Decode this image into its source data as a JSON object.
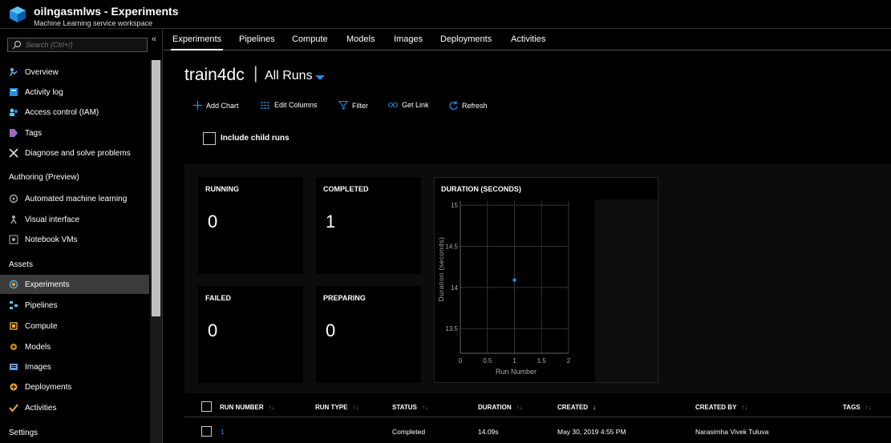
{
  "app": {
    "title": "oilngasmlws - Experiments",
    "subtitle": "Machine Learning service workspace",
    "brand_color": "#1f8fe5"
  },
  "search": {
    "placeholder": "Search (Ctrl+/)"
  },
  "sidebar": {
    "items_top": [
      {
        "label": "Overview",
        "icon": "overview-icon"
      },
      {
        "label": "Activity log",
        "icon": "activity-log-icon"
      },
      {
        "label": "Access control (IAM)",
        "icon": "access-control-icon"
      },
      {
        "label": "Tags",
        "icon": "tag-icon"
      },
      {
        "label": "Diagnose and solve problems",
        "icon": "wrench-icon"
      }
    ],
    "section_authoring": "Authoring (Preview)",
    "items_authoring": [
      {
        "label": "Automated machine learning",
        "icon": "automl-icon"
      },
      {
        "label": "Visual interface",
        "icon": "visual-interface-icon"
      },
      {
        "label": "Notebook VMs",
        "icon": "notebook-icon"
      }
    ],
    "section_assets": "Assets",
    "items_assets": [
      {
        "label": "Experiments",
        "icon": "experiments-icon",
        "selected": true
      },
      {
        "label": "Pipelines",
        "icon": "pipelines-icon"
      },
      {
        "label": "Compute",
        "icon": "compute-icon"
      },
      {
        "label": "Models",
        "icon": "models-icon"
      },
      {
        "label": "Images",
        "icon": "images-icon"
      },
      {
        "label": "Deployments",
        "icon": "deployments-icon"
      },
      {
        "label": "Activities",
        "icon": "activities-icon"
      }
    ],
    "section_settings": "Settings"
  },
  "tabs": [
    "Experiments",
    "Pipelines",
    "Compute",
    "Models",
    "Images",
    "Deployments",
    "Activities"
  ],
  "experiment": {
    "name": "train4dc",
    "separator": "|",
    "run_filter": "All Runs"
  },
  "toolbar": {
    "add_chart": "Add Chart",
    "edit_columns": "Edit Columns",
    "filter": "Filter",
    "get_link": "Get Link",
    "refresh": "Refresh"
  },
  "include_child_runs": "Include child runs",
  "cards": {
    "running": {
      "label": "RUNNING",
      "value": "0"
    },
    "completed": {
      "label": "COMPLETED",
      "value": "1"
    },
    "failed": {
      "label": "FAILED",
      "value": "0"
    },
    "preparing": {
      "label": "PREPARING",
      "value": "0"
    }
  },
  "chart_data": {
    "type": "scatter",
    "title": "DURATION (SECONDS)",
    "xlabel": "Run Number",
    "ylabel": "Duration (seconds)",
    "x_ticks": [
      "0",
      "0.5",
      "1",
      "1.5",
      "2"
    ],
    "y_ticks": [
      "15",
      "14.5",
      "14",
      "13.5"
    ],
    "xlim": [
      0,
      2
    ],
    "ylim": [
      13.2,
      15.05
    ],
    "grid": true,
    "points": [
      {
        "x": 1,
        "y": 14.09
      }
    ],
    "color": "#1f8fe5"
  },
  "table": {
    "columns": [
      "RUN NUMBER",
      "RUN TYPE",
      "STATUS",
      "DURATION",
      "CREATED",
      "CREATED BY",
      "TAGS"
    ],
    "rows": [
      {
        "run_number": "1",
        "run_type": "",
        "status": "Completed",
        "duration": "14.09s",
        "created": "May 30, 2019 4:55 PM",
        "created_by": "Narasimha Vivek Tuluva",
        "tags": ""
      }
    ]
  }
}
